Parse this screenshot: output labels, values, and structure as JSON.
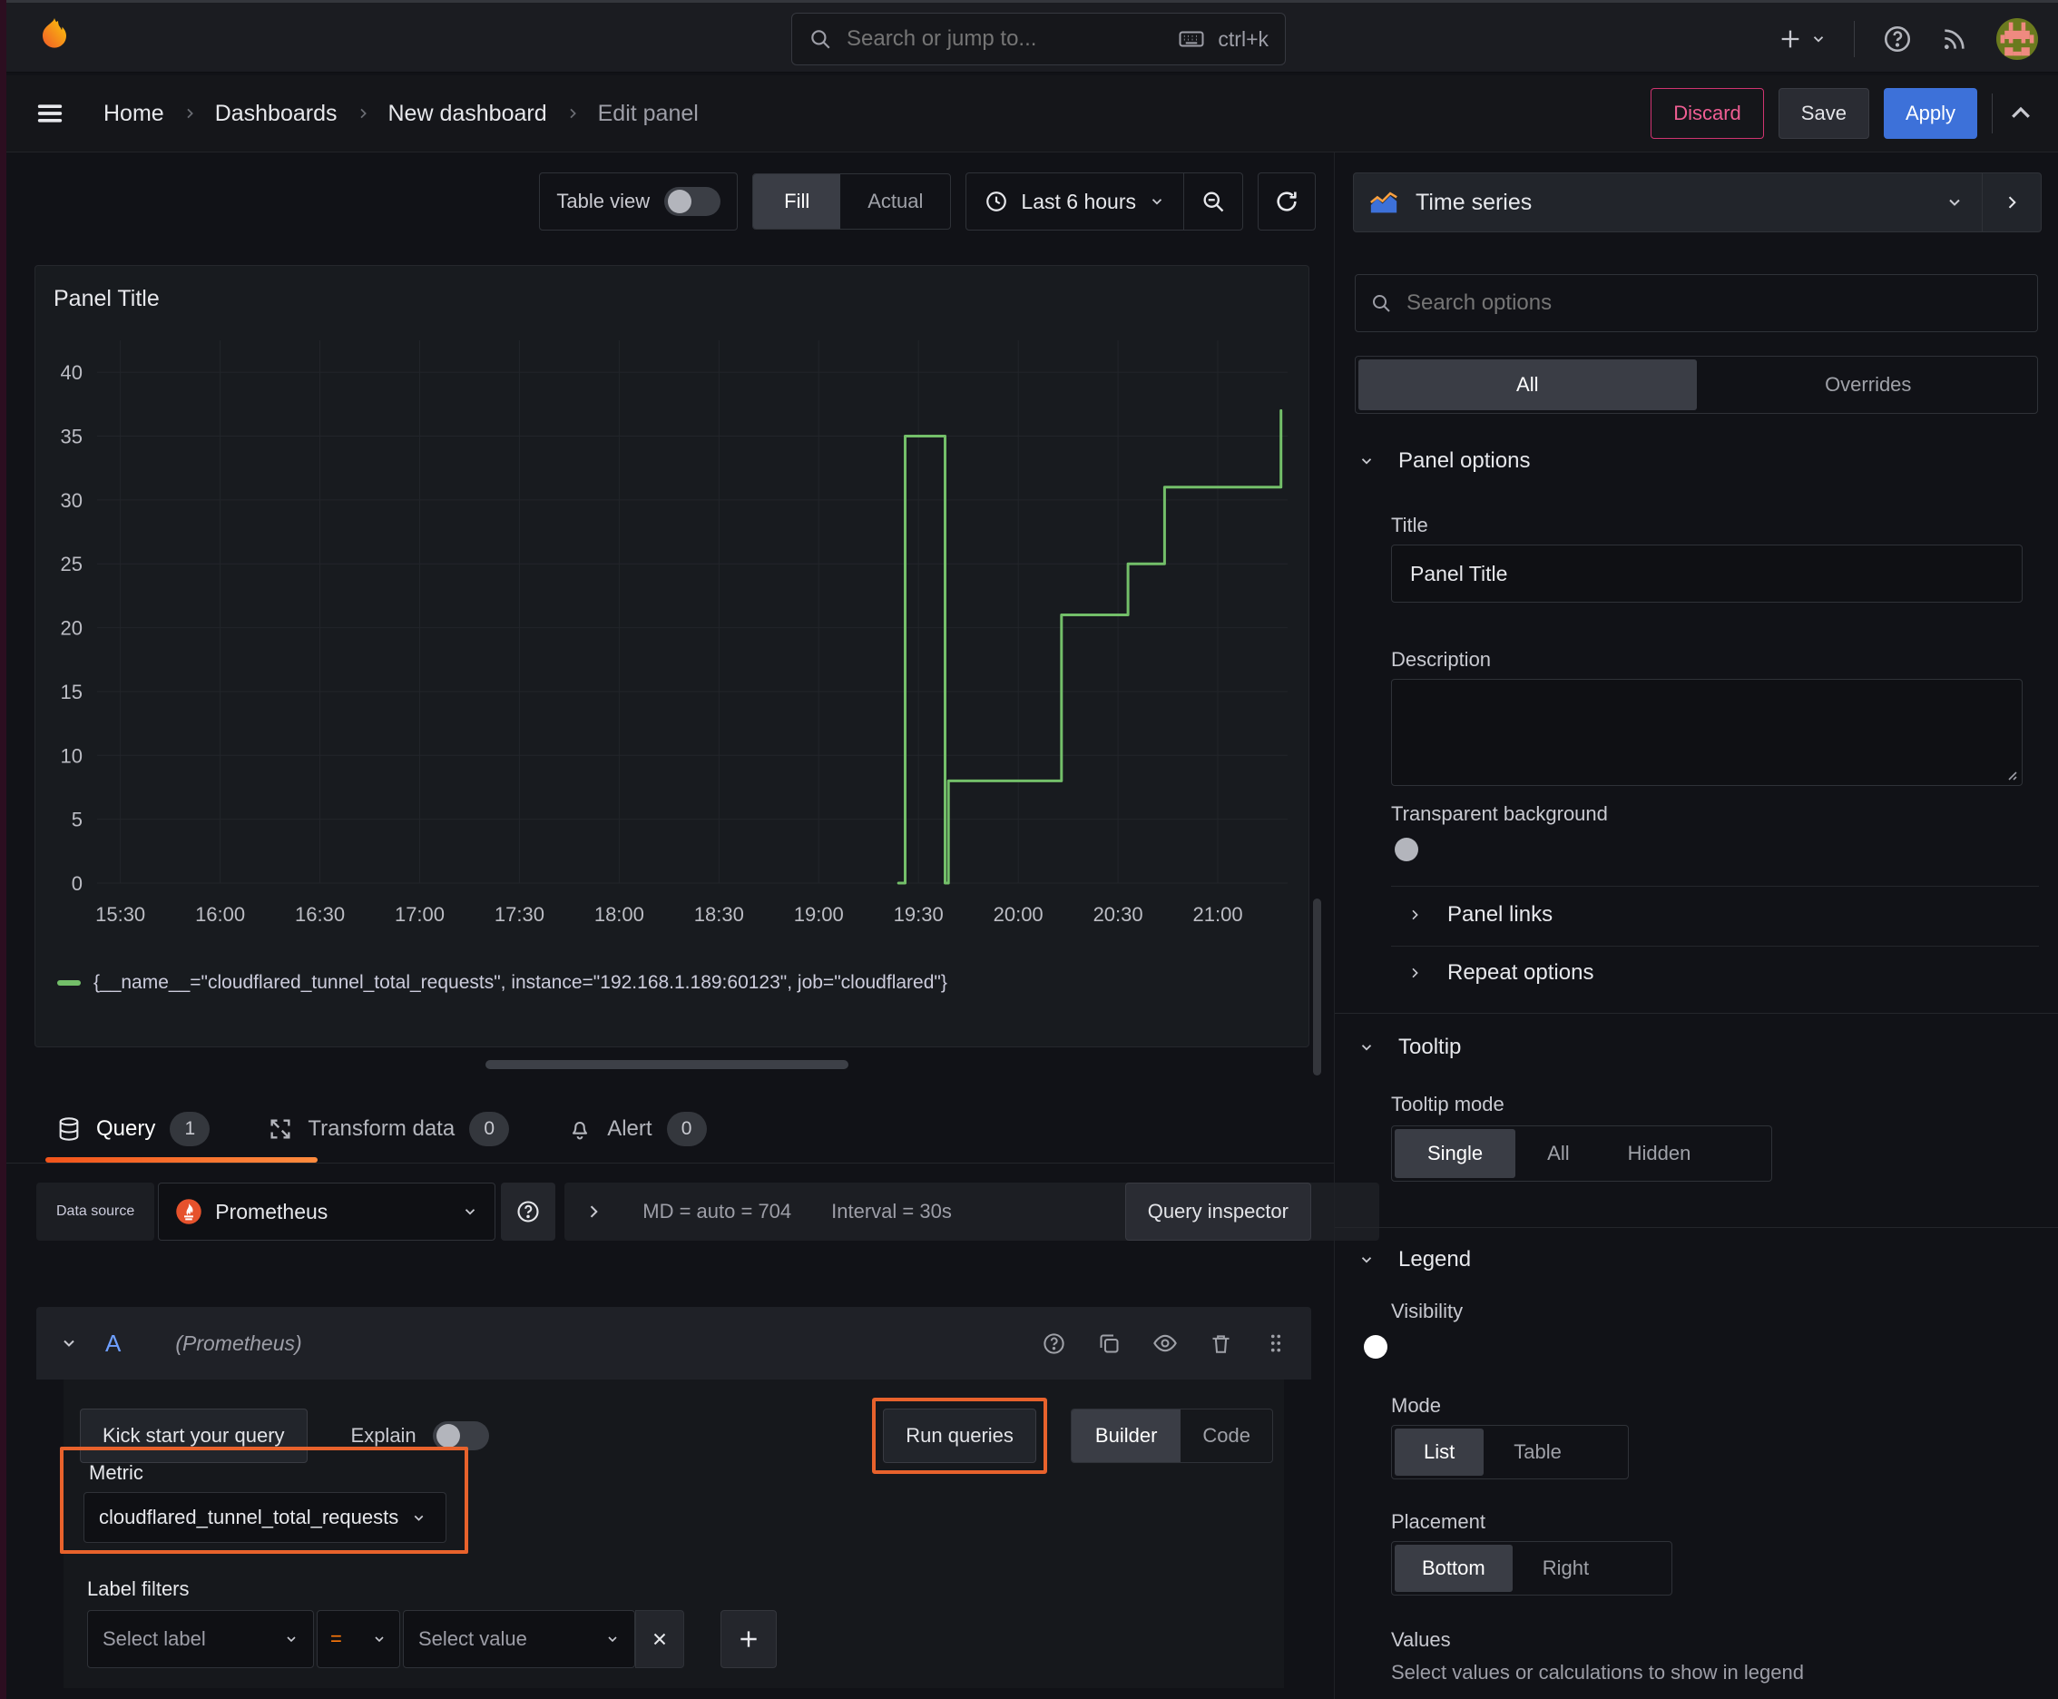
{
  "topbar": {
    "search_placeholder": "Search or jump to...",
    "shortcut": "ctrl+k"
  },
  "breadcrumb": {
    "items": [
      "Home",
      "Dashboards",
      "New dashboard",
      "Edit panel"
    ]
  },
  "actions": {
    "discard": "Discard",
    "save": "Save",
    "apply": "Apply"
  },
  "view_toolbar": {
    "table_view": "Table view",
    "fill": "Fill",
    "actual": "Actual",
    "time_range": "Last 6 hours"
  },
  "panel": {
    "title": "Panel Title"
  },
  "chart_data": {
    "type": "line",
    "title": "Panel Title",
    "x_start": "15:23",
    "x_end": "21:21",
    "y_min": 0,
    "y_max": 42.5,
    "x_ticks": [
      "15:30",
      "16:00",
      "16:30",
      "17:00",
      "17:30",
      "18:00",
      "18:30",
      "19:00",
      "19:30",
      "20:00",
      "20:30",
      "21:00"
    ],
    "y_ticks": [
      0,
      5,
      10,
      15,
      20,
      25,
      30,
      35,
      40
    ],
    "grid": true,
    "legend_position": "bottom",
    "series": [
      {
        "name": "{__name__=\"cloudflared_tunnel_total_requests\", instance=\"192.168.1.189:60123\", job=\"cloudflared\"}",
        "color": "#73bf69",
        "points": [
          [
            "19:24",
            0
          ],
          [
            "19:26",
            0
          ],
          [
            "19:26",
            35
          ],
          [
            "19:38",
            35
          ],
          [
            "19:38",
            0
          ],
          [
            "19:39",
            0
          ],
          [
            "19:39",
            8
          ],
          [
            "20:13",
            8
          ],
          [
            "20:13",
            21
          ],
          [
            "20:33",
            21
          ],
          [
            "20:33",
            25
          ],
          [
            "20:44",
            25
          ],
          [
            "20:44",
            31
          ],
          [
            "21:19",
            31
          ],
          [
            "21:19",
            37
          ]
        ]
      }
    ]
  },
  "tabs": [
    {
      "label": "Query",
      "count": "1"
    },
    {
      "label": "Transform data",
      "count": "0"
    },
    {
      "label": "Alert",
      "count": "0"
    }
  ],
  "query_editor": {
    "datasource_label": "Data source",
    "datasource_name": "Prometheus",
    "stats_md": "MD = auto = 704",
    "stats_interval": "Interval = 30s",
    "inspector": "Query inspector",
    "ref_id": "A",
    "ref_note": "(Prometheus)",
    "kickstart": "Kick start your query",
    "explain": "Explain",
    "run_queries": "Run queries",
    "builder": "Builder",
    "code": "Code",
    "metric_label": "Metric",
    "metric_value": "cloudflared_tunnel_total_requests",
    "label_filters_label": "Label filters",
    "select_label": "Select label",
    "operator": "=",
    "select_value": "Select value"
  },
  "sidebar": {
    "visualization": "Time series",
    "search_placeholder": "Search options",
    "tabs": {
      "all": "All",
      "overrides": "Overrides"
    },
    "panel_options": {
      "header": "Panel options",
      "title_label": "Title",
      "title_value": "Panel Title",
      "description_label": "Description",
      "transparent_label": "Transparent background"
    },
    "panel_links": "Panel links",
    "repeat_options": "Repeat options",
    "tooltip": {
      "header": "Tooltip",
      "mode_label": "Tooltip mode",
      "options": [
        "Single",
        "All",
        "Hidden"
      ]
    },
    "legend": {
      "header": "Legend",
      "visibility_label": "Visibility",
      "mode_label": "Mode",
      "mode_options": [
        "List",
        "Table"
      ],
      "placement_label": "Placement",
      "placement_options": [
        "Bottom",
        "Right"
      ],
      "values_label": "Values",
      "values_hint": "Select values or calculations to show in legend"
    }
  }
}
